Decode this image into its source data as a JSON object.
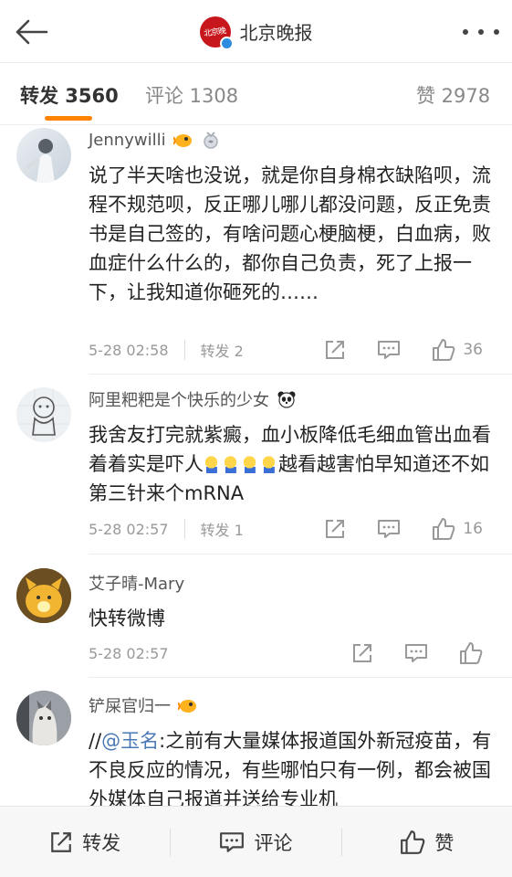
{
  "header": {
    "title": "北京晚报"
  },
  "tabs": [
    {
      "label": "转发 3560"
    },
    {
      "label": "评论 1308"
    },
    {
      "label": "赞 2978"
    }
  ],
  "comments": [
    {
      "user": "Jennywilli",
      "text": "说了半天啥也没说，就是你自身棉衣缺陷呗，流程不规范呗，反正哪儿哪儿都没问题，反正免责书是自己签的，有啥问题心梗脑梗，白血病，败血症什么什么的，都你自己负责，死了上报一下，让我知道你砸死的……",
      "time": "5-28 02:58",
      "repost": "转发 2",
      "likes": "36"
    },
    {
      "user": "阿里粑粑是个快乐的少女",
      "text": "我舍友打完就紫癜，血小板降低毛细血管出血看着着实是吓人",
      "text_after": "越看越害怕早知道还不如第三针来个mRNA",
      "time": "5-28 02:57",
      "repost": "转发 1",
      "likes": "16"
    },
    {
      "user": "艾子晴-Mary",
      "text": "快转微博",
      "time": "5-28 02:57"
    },
    {
      "user": "铲屎官归一",
      "text_prefix": "//",
      "mention": "@玉名",
      "text": ":之前有大量媒体报道国外新冠疫苗，有不良反应的情况，有些哪怕只有一例，都会被国外媒体自己报道并送给专业机"
    }
  ],
  "bottom": {
    "repost": "转发",
    "comment": "评论",
    "like": "赞"
  },
  "colors": {
    "accent": "#ff8200",
    "mention": "#4a79b5",
    "brand_red": "#c8161d",
    "verified": "#2d8ce0"
  }
}
